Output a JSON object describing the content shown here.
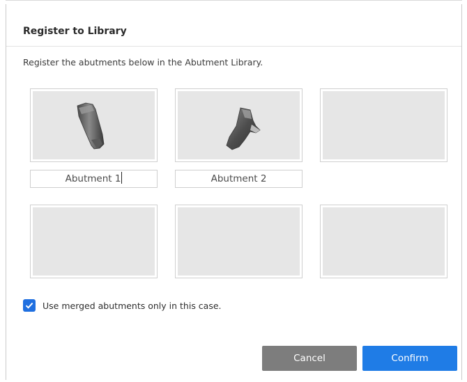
{
  "dialog": {
    "title": "Register to Library",
    "description": "Register the abutments below in the Abutment Library."
  },
  "abutments": [
    {
      "name": "Abutment 1",
      "icon": "abutment-model-1"
    },
    {
      "name": "Abutment 2",
      "icon": "abutment-model-2"
    }
  ],
  "checkbox": {
    "label": "Use merged abutments only in this case.",
    "checked": true,
    "color": "#1f6fe0"
  },
  "buttons": {
    "cancel": "Cancel",
    "confirm": "Confirm"
  },
  "colors": {
    "confirm": "#1f7ce6",
    "cancel": "#7d7d7d",
    "tile": "#e6e6e6"
  }
}
